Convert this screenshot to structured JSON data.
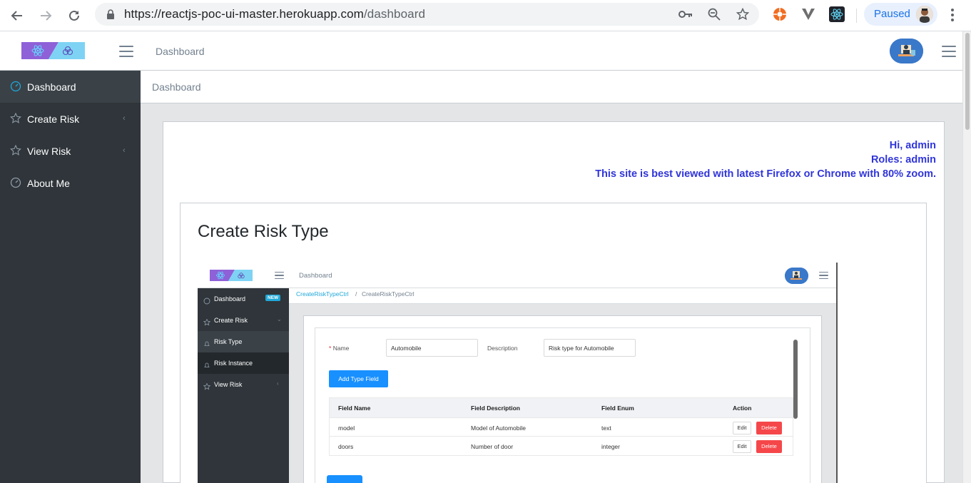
{
  "browser": {
    "url_host": "https://reactjs-poc-ui-master.herokuapp.com",
    "url_path": "/dashboard",
    "profile_label": "Paused"
  },
  "header": {
    "title": "Dashboard"
  },
  "sidebar": {
    "items": [
      {
        "label": "Dashboard",
        "icon": "speedometer-icon",
        "active": true
      },
      {
        "label": "Create Risk",
        "icon": "star-icon",
        "chevron": "‹"
      },
      {
        "label": "View Risk",
        "icon": "star-icon",
        "chevron": "‹"
      },
      {
        "label": "About Me",
        "icon": "speedometer-icon"
      }
    ]
  },
  "breadcrumb": {
    "current": "Dashboard"
  },
  "greeting": {
    "hi": "Hi, admin",
    "roles": "Roles: admin",
    "note": "This site is best viewed with latest Firefox or Chrome with 80% zoom."
  },
  "section": {
    "title": "Create Risk Type"
  },
  "screenshot": {
    "header_title": "Dashboard",
    "sidebar": [
      {
        "label": "Dashboard",
        "badge": "NEW"
      },
      {
        "label": "Create Risk",
        "chevron": "⌄"
      },
      {
        "label": "Risk Type"
      },
      {
        "label": "Risk Instance"
      },
      {
        "label": "View Risk",
        "chevron": "‹"
      }
    ],
    "breadcrumb": [
      "CreateRiskTypeCtrl",
      "/",
      "CreateRiskTypeCtrl"
    ],
    "form": {
      "name_label": "Name",
      "name_required": "*",
      "name_value": "Automobile",
      "description_label": "Description",
      "description_value": "Risk type for Automobile",
      "add_button": "Add Type Field"
    },
    "table": {
      "headers": [
        "Field Name",
        "Field Description",
        "Field Enum",
        "Action"
      ],
      "rows": [
        {
          "name": "model",
          "description": "Model of Automobile",
          "enum": "text"
        },
        {
          "name": "doors",
          "description": "Number of door",
          "enum": "integer"
        }
      ],
      "edit_label": "Edit",
      "delete_label": "Delete"
    }
  },
  "colors": {
    "sidebar_bg": "#2f353a",
    "greeting_text": "#3035d9",
    "primary_button": "#1890ff",
    "delete_button": "#f5474a",
    "badge": "#20a8d8"
  }
}
